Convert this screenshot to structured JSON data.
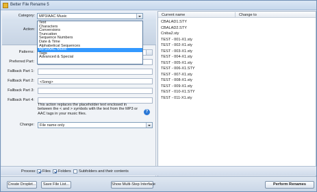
{
  "window": {
    "title": "Better File Rename 5"
  },
  "left": {
    "category_label": "Category:",
    "category_value": "MP3/AAC Music",
    "category_options": [
      "Text",
      "Characters",
      "Conversions",
      "Truncation",
      "Sequence Numbers",
      "Date & Time",
      "Alphabetical Sequences",
      "MP3/AAC Music",
      "Tags",
      "Advanced & Special"
    ],
    "category_selected_index": 7,
    "action_label": "Action:",
    "patterns_label": "Patterns:",
    "preferred_part_label": "Preferred Part:",
    "fallback1_label": "Fallback Part 1:",
    "fallback2_label": "Fallback Part 2:",
    "fallback2_value": "<Song>",
    "fallback3_label": "Fallback Part 3:",
    "fallback4_label": "Fallback Part 4:",
    "description": "This action replaces the placeholder text enclosed in between the < and > symbols with the text from the MP3 or AAC tags in your music files.",
    "change_label": "Change:",
    "change_value": "File name only"
  },
  "filelist": {
    "col_current": "Current name",
    "col_change": "Change to",
    "rows": [
      "CBALAD1.STY",
      "CBALAD2.STY",
      "Cniba2.sty",
      "TEST - 001-X1.sty",
      "TEST - 002-X1.sty",
      "TEST - 003-X1.sty",
      "TEST - 004-X1.sty",
      "TEST - 005-X1.sty",
      "TEST - 006-X1.STY",
      "TEST - 007-X1.sty",
      "TEST - 008-X1.sty",
      "TEST - 009-X1.sty",
      "TEST - 010-X1.STY",
      "TEST - 011-X1.sty"
    ]
  },
  "process": {
    "label": "Process:",
    "files": "Files",
    "folders": "Folders",
    "subfolders": "Subfolders and their contents"
  },
  "buttons": {
    "create_droplet": "Create Droplet...",
    "save_file_list": "Save File List...",
    "multi_step": "Show Multi-Step Interface",
    "perform": "Perform Renames"
  },
  "icons": {
    "toolbar": [
      "⚙",
      "+",
      "▤",
      "+",
      "−",
      "✕"
    ]
  }
}
